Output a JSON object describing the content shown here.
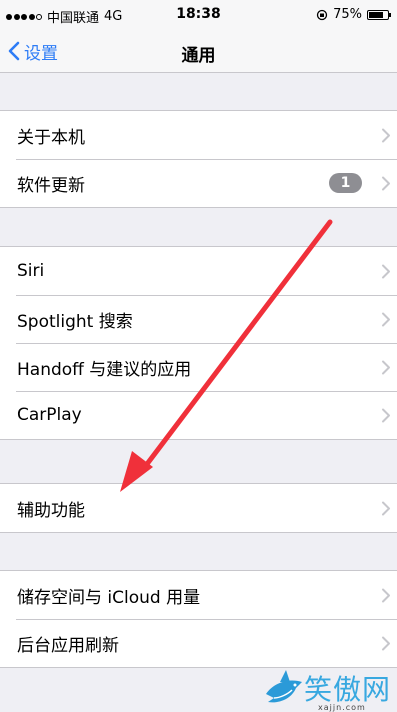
{
  "status_bar": {
    "carrier": "中国联通",
    "network": "4G",
    "time": "18:38",
    "battery": "75%",
    "battery_level": 0.75
  },
  "nav": {
    "back_label": "设置",
    "title": "通用"
  },
  "groups": [
    {
      "rows": [
        {
          "label": "关于本机"
        },
        {
          "label": "软件更新",
          "badge": "1"
        }
      ]
    },
    {
      "rows": [
        {
          "label": "Siri"
        },
        {
          "label": "Spotlight 搜索"
        },
        {
          "label": "Handoff 与建议的应用"
        },
        {
          "label": "CarPlay"
        }
      ]
    },
    {
      "rows": [
        {
          "label": "辅助功能"
        }
      ]
    },
    {
      "rows": [
        {
          "label": "储存空间与 iCloud 用量"
        },
        {
          "label": "后台应用刷新"
        }
      ]
    }
  ],
  "watermark": {
    "text": "笑傲网",
    "url": "xajjn.com"
  },
  "colors": {
    "accent": "#2d7cf6",
    "annotation_arrow": "#f0303a",
    "badge": "#8e8e93"
  }
}
